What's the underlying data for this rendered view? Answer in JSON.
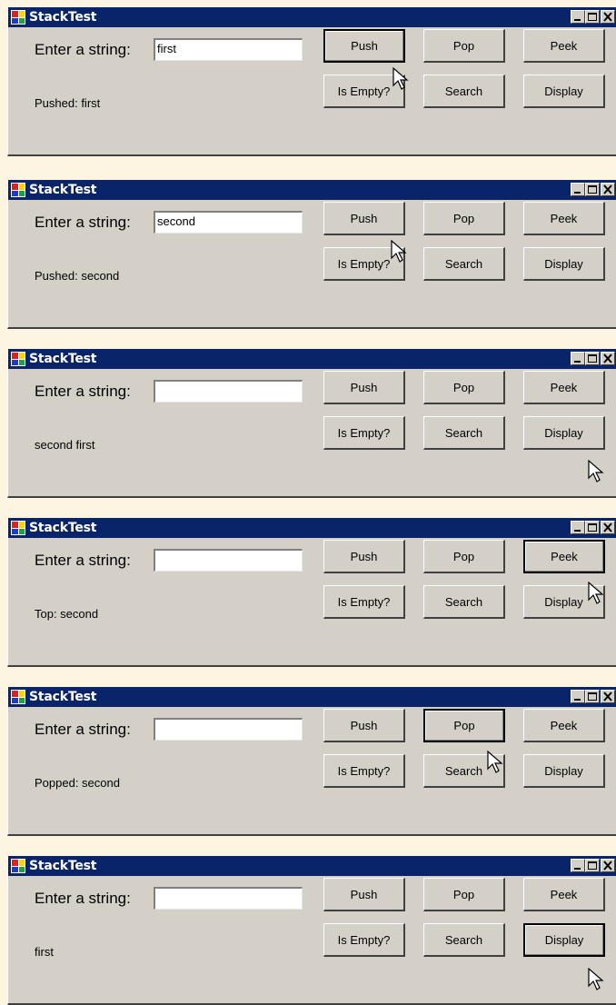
{
  "windows": [
    {
      "title": "StackTest",
      "label": "Enter a string:",
      "input_value": "first",
      "status": "Pushed: first",
      "buttons": [
        "Push",
        "Pop",
        "Peek",
        "Is Empty?",
        "Search",
        "Display"
      ]
    },
    {
      "title": "StackTest",
      "label": "Enter a string:",
      "input_value": "second",
      "status": "Pushed: second",
      "buttons": [
        "Push",
        "Pop",
        "Peek",
        "Is Empty?",
        "Search",
        "Display"
      ]
    },
    {
      "title": "StackTest",
      "label": "Enter a string:",
      "input_value": "",
      "status": "second first",
      "buttons": [
        "Push",
        "Pop",
        "Peek",
        "Is Empty?",
        "Search",
        "Display"
      ]
    },
    {
      "title": "StackTest",
      "label": "Enter a string:",
      "input_value": "",
      "status": "Top: second",
      "buttons": [
        "Push",
        "Pop",
        "Peek",
        "Is Empty?",
        "Search",
        "Display"
      ]
    },
    {
      "title": "StackTest",
      "label": "Enter a string:",
      "input_value": "",
      "status": "Popped: second",
      "buttons": [
        "Push",
        "Pop",
        "Peek",
        "Is Empty?",
        "Search",
        "Display"
      ]
    },
    {
      "title": "StackTest",
      "label": "Enter a string:",
      "input_value": "",
      "status": "first",
      "buttons": [
        "Push",
        "Pop",
        "Peek",
        "Is Empty?",
        "Search",
        "Display"
      ]
    }
  ],
  "colors": {
    "titlebar": "#0a246a",
    "window_face": "#d4d0c8",
    "page_background": "#fdf5e2"
  },
  "icons": {
    "app": "app-window-icon",
    "minimize": "minimize-icon",
    "maximize": "maximize-icon",
    "close": "close-icon",
    "pointer": "mouse-pointer-icon"
  }
}
